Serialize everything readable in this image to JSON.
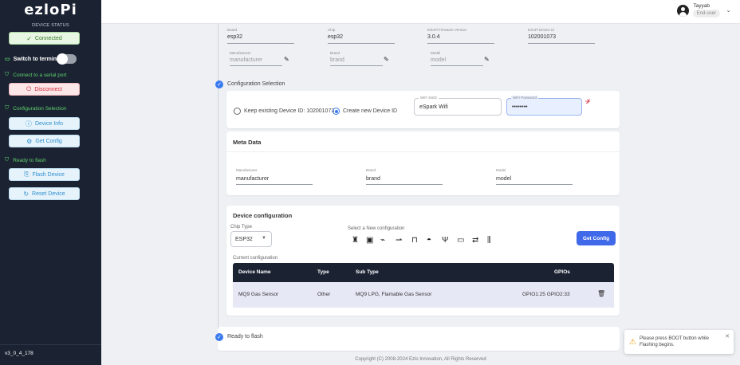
{
  "app": {
    "logo": "ezloPi",
    "version": "v3_0_4_178"
  },
  "sidebar": {
    "device_status": "DEVICE STATUS",
    "connected": "Connected",
    "switch_terminal": "Switch to terminal",
    "connect_serial": "Connect to a serial port",
    "disconnect": "Disconnect",
    "config_selection": "Configuration Selection",
    "device_info": "Device Info",
    "get_config": "Get Config",
    "ready_flash": "Ready to flash",
    "flash_device": "Flash Device",
    "reset_device": "Reset Device"
  },
  "header": {
    "user_name": "Tayyab",
    "user_role": "End-user"
  },
  "device_fields": {
    "board_label": "Board",
    "board": "esp32",
    "chip_label": "Chip",
    "chip": "esp32",
    "fw_label": "EzloPi Firmware Version",
    "fw": "3.0.4",
    "devid_label": "EzloPi Device Id",
    "devid": "102001073",
    "manufacturer_label": "Manufacturer",
    "manufacturer": "manufacturer",
    "brand_label": "Brand",
    "brand": "brand",
    "model_label": "Model",
    "model": "model"
  },
  "config_selection": {
    "title": "Configuration Selection",
    "keep_existing": "Keep existing Device ID: 102001073",
    "create_new": "Create new Device ID",
    "wifi_ssid_label": "WiFi SSID",
    "wifi_ssid": "eSpark Wifi",
    "wifi_pass_label": "WiFi Password",
    "wifi_pass": "••••••••"
  },
  "meta": {
    "title": "Meta Data",
    "manufacturer_label": "Manufacturer",
    "manufacturer": "manufacturer",
    "brand_label": "Brand",
    "brand": "brand",
    "model_label": "Model",
    "model": "model"
  },
  "device_config": {
    "title": "Device configuration",
    "chip_type_label": "Chip Type",
    "chip_type": "ESP32",
    "select_new": "Select a New configuration",
    "get_config": "Get Config",
    "current_label": "Current configuration",
    "headers": [
      "Device Name",
      "Type",
      "Sub Type",
      "GPIOs"
    ],
    "rows": [
      [
        "MQ9 Gas Sensor",
        "Other",
        "MQ9 LPG, Flamable Gas Sensor",
        "GPIO1:25 GPIO2:33"
      ]
    ]
  },
  "ready": {
    "title": "Ready to flash"
  },
  "footer": {
    "copyright": "Copyright (C) 2008-2024 Ezlo Innovation, All Rights Reserved"
  },
  "toast": {
    "message": "Please press BOOT button while Flashing begins."
  },
  "colors": {
    "sidebar": "#1b2333",
    "accent": "#3f69e8",
    "success": "#5fd06b",
    "danger": "#d32f3d"
  }
}
